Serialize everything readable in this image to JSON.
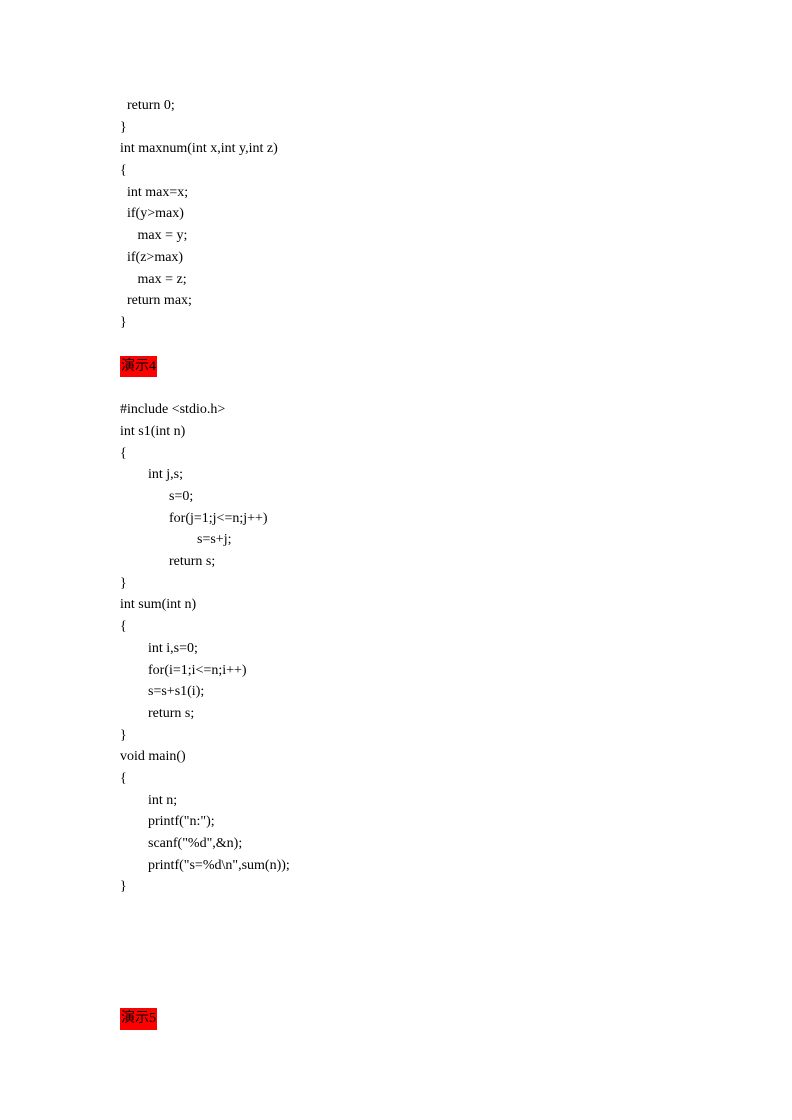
{
  "code1": "  return 0;\n}\nint maxnum(int x,int y,int z)\n{\n  int max=x;\n  if(y>max)\n     max = y;\n  if(z>max)\n     max = z;\n  return max;\n}",
  "demo4": {
    "prefix": "演示",
    "num": "4"
  },
  "code2": "#include <stdio.h>\nint s1(int n)\n{\n        int j,s;\n              s=0;\n              for(j=1;j<=n;j++)\n                      s=s+j;\n              return s;\n}\nint sum(int n)\n{\n        int i,s=0;\n        for(i=1;i<=n;i++)\n        s=s+s1(i);\n        return s;\n}\nvoid main()\n{\n        int n;\n        printf(\"n:\");\n        scanf(\"%d\",&n);\n        printf(\"s=%d\\n\",sum(n));\n}",
  "demo5": {
    "prefix": "演示",
    "num": "5"
  }
}
